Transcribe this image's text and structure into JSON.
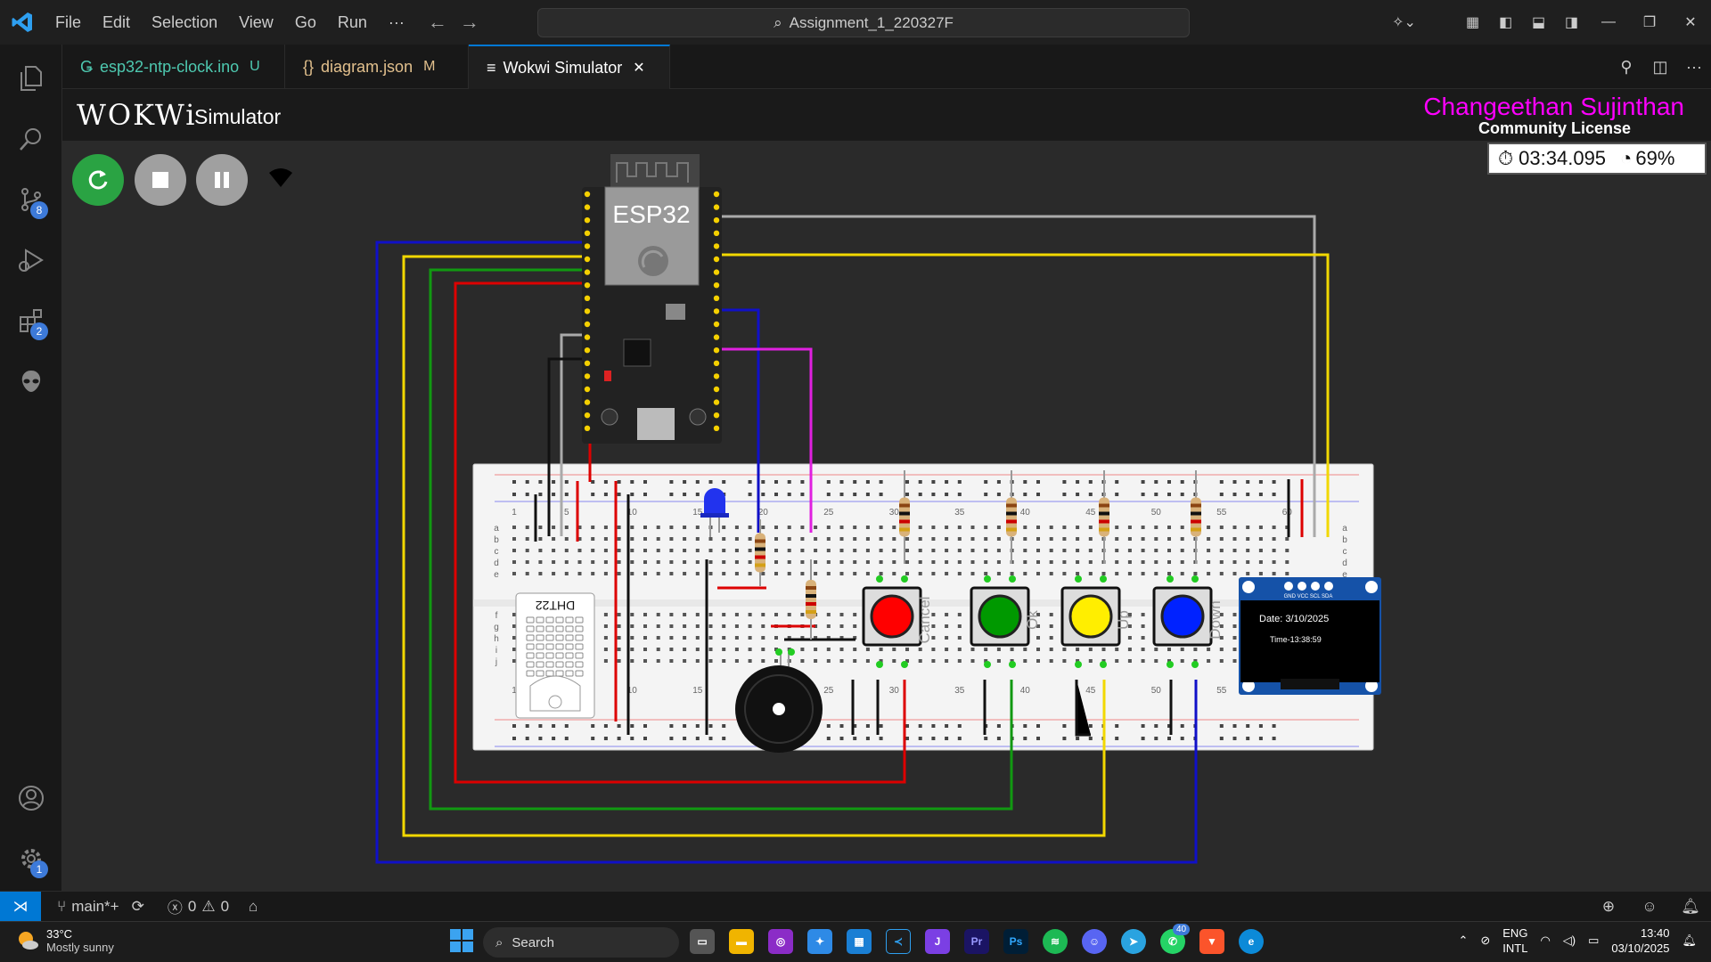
{
  "menu": {
    "items": [
      "File",
      "Edit",
      "Selection",
      "View",
      "Go",
      "Run",
      "···"
    ]
  },
  "command_center": {
    "text": "Assignment_1_220327F"
  },
  "activity_bar": {
    "scm_badge": "8",
    "extensions_badge": "2",
    "settings_badge": "1"
  },
  "tabs": [
    {
      "label": "esp32-ntp-clock.ino",
      "status": "U",
      "color": "#4ec9b0"
    },
    {
      "label": "diagram.json",
      "status": "M",
      "color": "#e2c08d"
    },
    {
      "label": "Wokwi Simulator",
      "status": "✕",
      "color": "#ffffff"
    }
  ],
  "wokwi": {
    "logo": "WOKWi",
    "logo_sub": "Simulator",
    "license_name": "Changeethan Sujinthan",
    "license_type": "Community License",
    "time": "03:34.095",
    "speed": "69%"
  },
  "circuit": {
    "esp_label": "ESP32",
    "dht_label": "DHT22",
    "buttons": [
      {
        "label": "Cancel",
        "color": "#ff0000"
      },
      {
        "label": "Ok",
        "color": "#009900"
      },
      {
        "label": "Up",
        "color": "#ffee00"
      },
      {
        "label": "Down",
        "color": "#0022ff"
      }
    ],
    "oled_pins": "GND VCC SCL SDA",
    "oled_line1": "Date: 3/10/2025",
    "oled_line2": "Time-13:38:59",
    "row_labels": [
      "a",
      "b",
      "c",
      "d",
      "e",
      "f",
      "g",
      "h",
      "i",
      "j"
    ],
    "col_numbers": [
      "1",
      "5",
      "10",
      "15",
      "20",
      "25",
      "30",
      "35",
      "40",
      "45",
      "50",
      "55",
      "60"
    ],
    "wire_colors": {
      "blue": "#1010c8",
      "yellow": "#f2d800",
      "green": "#119911",
      "red": "#dd0000",
      "magenta": "#e020e0",
      "gray": "#aaaaaa",
      "black": "#111111"
    }
  },
  "statusbar": {
    "branch": "main*+",
    "errors": "0",
    "warnings": "0"
  },
  "taskbar": {
    "temp": "33°C",
    "weather": "Mostly sunny",
    "search": "Search",
    "lang1": "ENG",
    "lang2": "INTL",
    "time": "13:40",
    "date": "03/10/2025",
    "whatsapp_badge": "40"
  }
}
